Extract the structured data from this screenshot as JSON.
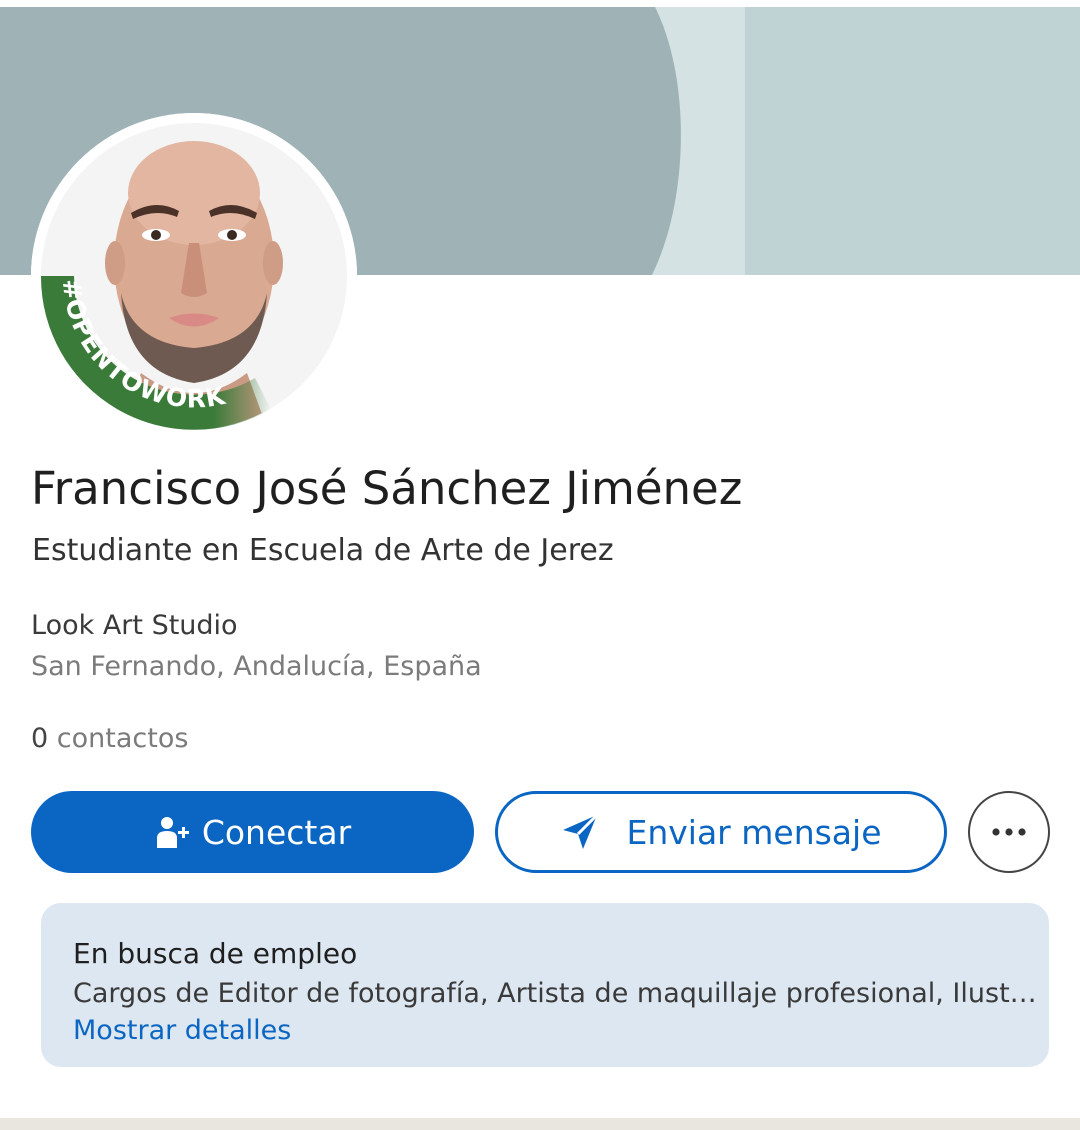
{
  "profile": {
    "name": "Francisco José Sánchez Jiménez",
    "headline": "Estudiante en Escuela de Arte de Jerez",
    "company": "Look Art Studio",
    "location": "San Fernando, Andalucía, España",
    "contacts_count": "0",
    "contacts_label": "contactos",
    "badge_text": "#OPENTOWORK"
  },
  "actions": {
    "connect_label": "Conectar",
    "message_label": "Enviar mensaje",
    "more_icon": "more-horizontal-icon"
  },
  "open_to_work": {
    "title": "En busca de empleo",
    "description": "Cargos de Editor de fotografía, Artista de maquillaje profesional, Ilustrador",
    "link_label": "Mostrar detalles"
  },
  "colors": {
    "brand_blue": "#0a66c2",
    "opentowork_green": "#3a7b39",
    "card_background": "#dde7f1",
    "banner_dark": "#9fb2b6",
    "banner_light": "#bfd2d4"
  }
}
